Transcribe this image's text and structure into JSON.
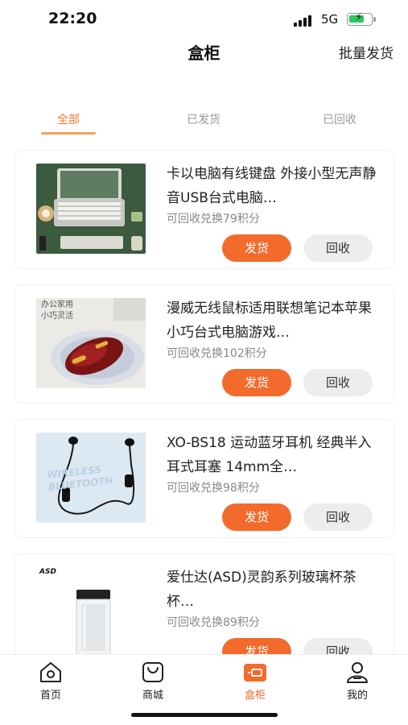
{
  "status_bar": {
    "time": "22:20",
    "network": "5G",
    "battery_level": 0.7
  },
  "nav": {
    "title": "盒柜",
    "action": "批量发货"
  },
  "tabs": [
    {
      "label": "全部",
      "active": true
    },
    {
      "label": "已发货",
      "active": false
    },
    {
      "label": "已回收",
      "active": false
    }
  ],
  "items": [
    {
      "title": "卡以电脑有线键盘 外接小型无声静音USB台式电脑…",
      "points": "可回收兑换79积分",
      "ship_label": "发货",
      "recycle_label": "回收"
    },
    {
      "title": "漫威无线鼠标适用联想笔记本苹果小巧台式电脑游戏…",
      "points": "可回收兑换102积分",
      "ship_label": "发货",
      "recycle_label": "回收",
      "image_text": "办公家用\n小巧灵活"
    },
    {
      "title": "XO-BS18 运动蓝牙耳机 经典半入耳式耳塞 14mm全…",
      "points": "可回收兑换98积分",
      "ship_label": "发货",
      "recycle_label": "回收",
      "image_text": "WIRELESS BLUETOOTH"
    },
    {
      "title": "爱仕达(ASD)灵韵系列玻璃杯茶杯…",
      "points": "可回收兑换89积分",
      "ship_label": "发货",
      "recycle_label": "回收",
      "image_text": "ASD"
    }
  ],
  "tabbar": [
    {
      "label": "首页",
      "icon": "home-icon",
      "active": false
    },
    {
      "label": "商城",
      "icon": "shopping-bag-icon",
      "active": false
    },
    {
      "label": "盒柜",
      "icon": "box-cabinet-icon",
      "active": true
    },
    {
      "label": "我的",
      "icon": "profile-icon",
      "active": false
    }
  ],
  "colors": {
    "accent": "#f36b2c",
    "tab_active": "#f07a32",
    "muted": "#999999"
  }
}
